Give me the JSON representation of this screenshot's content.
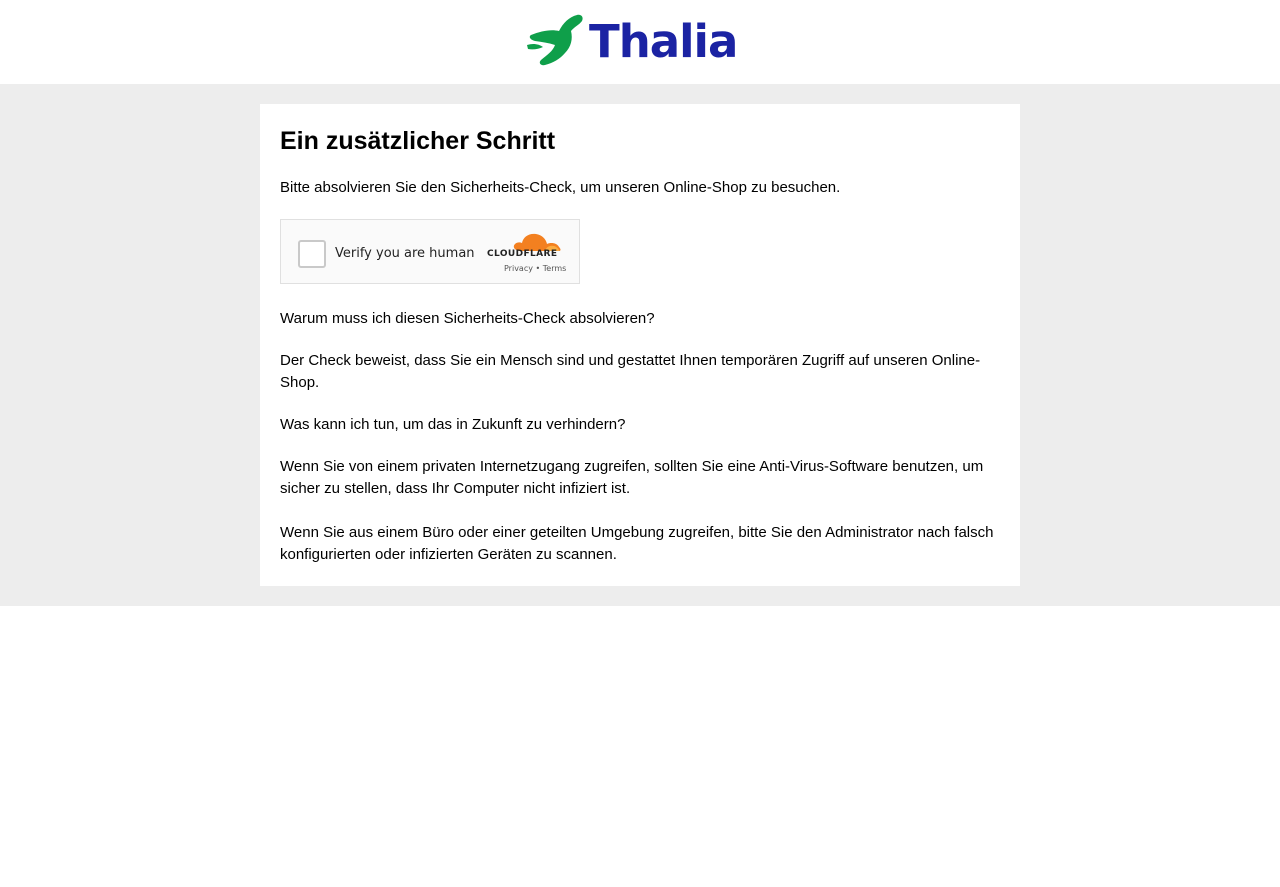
{
  "header": {
    "logo_text": "Thalia",
    "brand_color": "#1b23a3",
    "mermaid_color": "#0f9f4a"
  },
  "card": {
    "title": "Ein zusätzlicher Schritt",
    "intro": "Bitte absolvieren Sie den Sicherheits-Check, um unseren Online-Shop zu besuchen.",
    "why_question": "Warum muss ich diesen Sicherheits-Check absolvieren?",
    "why_answer": "Der Check beweist, dass Sie ein Mensch sind und gestattet Ihnen temporären Zugriff auf unseren Online-Shop.",
    "prevent_question": "Was kann ich tun, um das in Zukunft zu verhindern?",
    "prevent_answer_private": "Wenn Sie von einem privaten Internetzugang zugreifen, sollten Sie eine Anti-Virus-Software benutzen, um sicher zu stellen, dass Ihr Computer nicht infiziert ist.",
    "prevent_answer_office": "Wenn Sie aus einem Büro oder einer geteilten Umgebung zugreifen, bitte Sie den Administrator nach falsch konfigurierten oder infizierten Geräten zu scannen."
  },
  "captcha": {
    "label": "Verify you are human",
    "provider": "CLOUDFLARE",
    "privacy_link": "Privacy",
    "separator": "•",
    "terms_link": "Terms",
    "cloud_color": "#f38020"
  },
  "colors": {
    "band_background": "#ededed",
    "card_background": "#ffffff"
  }
}
